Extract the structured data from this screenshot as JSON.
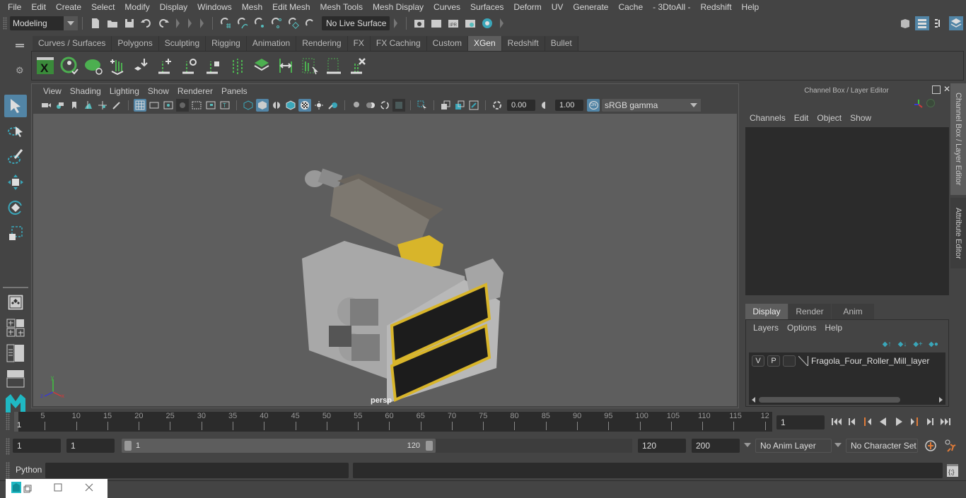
{
  "menubar": {
    "items": [
      "File",
      "Edit",
      "Create",
      "Select",
      "Modify",
      "Display",
      "Windows",
      "Mesh",
      "Edit Mesh",
      "Mesh Tools",
      "Mesh Display",
      "Curves",
      "Surfaces",
      "Deform",
      "UV",
      "Generate",
      "Cache",
      "- 3DtoAll -",
      "Redshift",
      "Help"
    ]
  },
  "statusline": {
    "mode": "Modeling",
    "live_surface": "No Live Surface"
  },
  "shelf": {
    "tabs": [
      "Curves / Surfaces",
      "Polygons",
      "Sculpting",
      "Rigging",
      "Animation",
      "Rendering",
      "FX",
      "FX Caching",
      "Custom",
      "XGen",
      "Redshift",
      "Bullet"
    ],
    "active_tab": "XGen"
  },
  "viewport": {
    "menu": [
      "View",
      "Shading",
      "Lighting",
      "Show",
      "Renderer",
      "Panels"
    ],
    "exposure": "0.00",
    "gamma": "1.00",
    "color_mgmt": "ON",
    "color_space": "sRGB gamma",
    "camera_label": "persp",
    "axis": {
      "x": "x",
      "y": "y",
      "z": "z"
    }
  },
  "channel_box": {
    "title": "Channel Box / Layer Editor",
    "menu": [
      "Channels",
      "Edit",
      "Object",
      "Show"
    ]
  },
  "layer_editor": {
    "tabs": [
      "Display",
      "Render",
      "Anim"
    ],
    "active_tab": "Display",
    "menu": [
      "Layers",
      "Options",
      "Help"
    ],
    "layers": [
      {
        "v": "V",
        "p": "P",
        "name": "Fragola_Four_Roller_Mill_layer"
      }
    ]
  },
  "side_tabs": [
    "Channel Box / Layer Editor",
    "Attribute Editor"
  ],
  "timeline": {
    "ticks": [
      5,
      10,
      15,
      20,
      25,
      30,
      35,
      40,
      45,
      50,
      55,
      60,
      65,
      70,
      75,
      80,
      85,
      90,
      95,
      100,
      105,
      110,
      115,
      "12"
    ],
    "start_label": "1",
    "current_frame": "1"
  },
  "range": {
    "start": "1",
    "playback_start": "1",
    "slider_min": "1",
    "slider_max": "120",
    "playback_end": "120",
    "end": "200",
    "anim_layer": "No Anim Layer",
    "character_set": "No Character Set"
  },
  "command_line": {
    "language": "Python",
    "input": "",
    "output": ""
  },
  "colors": {
    "accent": "#5285a6",
    "xgen_green": "#4caf50",
    "playhead": "#e07b39"
  }
}
